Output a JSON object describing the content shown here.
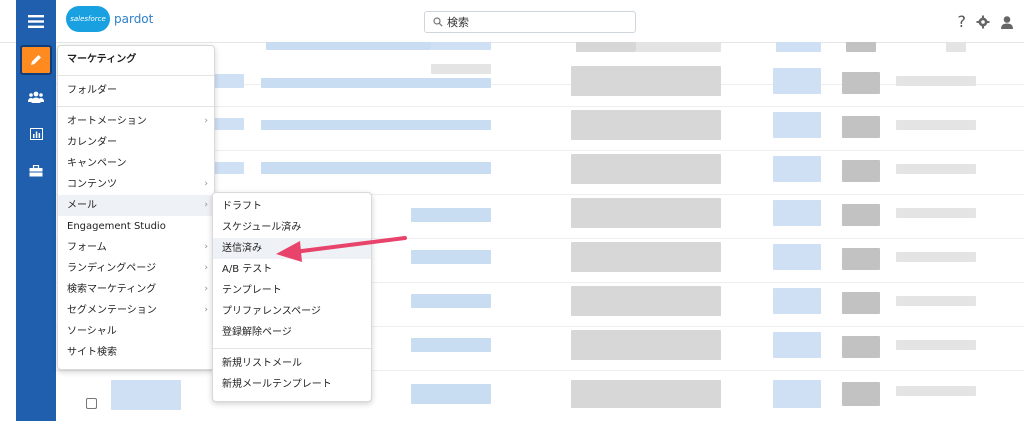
{
  "header": {
    "brand_cloud": "salesforce",
    "brand_name": "pardot",
    "search_placeholder": "検索",
    "help_icon": "?",
    "icons": [
      "help-icon",
      "gear-icon",
      "user-icon"
    ]
  },
  "rail": {
    "items": [
      "hamburger-icon",
      "pencil-icon",
      "people-icon",
      "report-icon",
      "briefcase-icon"
    ],
    "accent": "#ff8a1f",
    "bg": "#1f5fad"
  },
  "main_menu": {
    "title": "マーケティング",
    "items": [
      {
        "label": "フォルダー"
      },
      {
        "label": "オートメーション"
      },
      {
        "label": "カレンダー"
      },
      {
        "label": "キャンペーン"
      },
      {
        "label": "コンテンツ"
      },
      {
        "label": "メール"
      },
      {
        "label": "Engagement Studio"
      },
      {
        "label": "フォーム"
      },
      {
        "label": "ランディングページ"
      },
      {
        "label": "検索マーケティング"
      },
      {
        "label": "セグメンテーション"
      },
      {
        "label": "ソーシャル"
      },
      {
        "label": "サイト検索"
      }
    ],
    "chevron": "›"
  },
  "sub_menu": {
    "items": [
      {
        "label": "ドラフト"
      },
      {
        "label": "スケジュール済み"
      },
      {
        "label": "送信済み"
      },
      {
        "label": "A/B テスト"
      },
      {
        "label": "テンプレート"
      },
      {
        "label": "プリファレンスページ"
      },
      {
        "label": "登録解除ページ"
      },
      {
        "label": "新規リストメール"
      },
      {
        "label": "新規メールテンプレート"
      }
    ]
  },
  "annotation": {
    "color": "#e8436a"
  }
}
